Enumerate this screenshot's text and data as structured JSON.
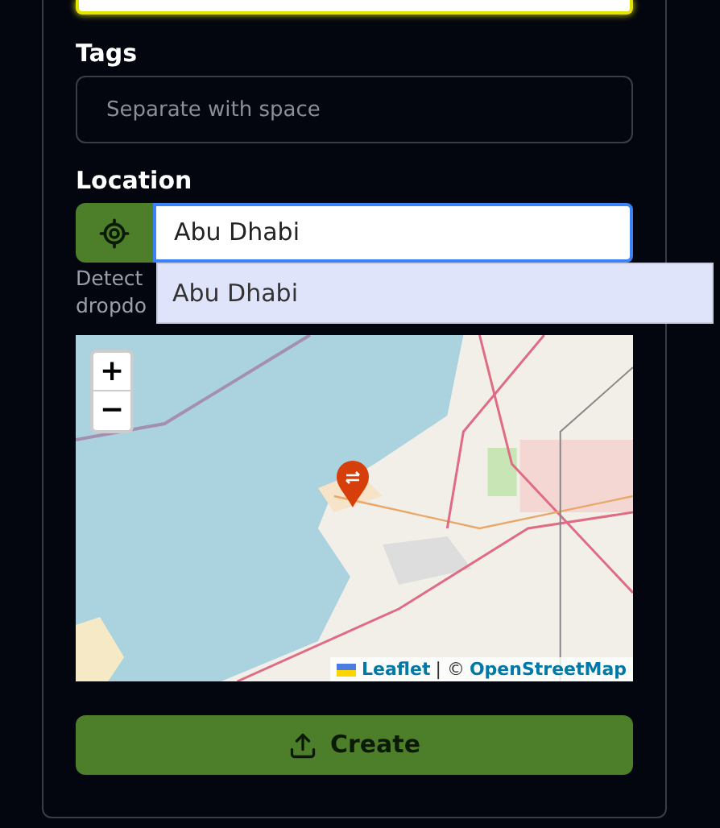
{
  "description_field": {
    "focused": true
  },
  "tags": {
    "label": "Tags",
    "placeholder": "Separate with space"
  },
  "location": {
    "label": "Location",
    "value": "Abu Dhabi",
    "helper_lines": [
      "Detect",
      "dropdo"
    ],
    "suggestions": [
      {
        "label": "Abu Dhabi",
        "selected": true
      }
    ]
  },
  "map": {
    "zoom_in": "+",
    "zoom_out": "−",
    "attribution_link_1": "Leaflet",
    "attribution_sep": "| ©",
    "attribution_link_2": "OpenStreetMap"
  },
  "submit": {
    "label": "Create"
  }
}
